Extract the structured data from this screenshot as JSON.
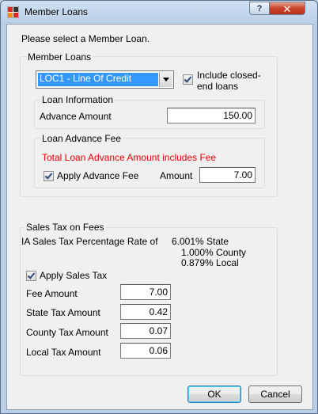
{
  "window": {
    "title": "Member Loans",
    "help_label": "?",
    "close_label": "✕"
  },
  "prompt": "Please select a Member Loan.",
  "member_loans": {
    "legend": "Member Loans",
    "selected_loan": "LOC1 - Line Of Credit",
    "include_closed_label_line1": "Include closed-",
    "include_closed_label_line2": "end loans",
    "include_closed_checked": true,
    "loan_information": {
      "legend": "Loan Information",
      "advance_amount_label": "Advance Amount",
      "advance_amount_value": "150.00"
    },
    "loan_advance_fee": {
      "legend": "Loan Advance Fee",
      "notice": "Total Loan Advance Amount includes Fee",
      "apply_fee_label": "Apply Advance Fee",
      "apply_fee_checked": true,
      "amount_label": "Amount",
      "amount_value": "7.00"
    }
  },
  "sales_tax": {
    "legend": "Sales Tax on Fees",
    "rate_label": "IA Sales Tax Percentage Rate of",
    "state_rate": "6.001% State",
    "county_rate": "1.000% County",
    "local_rate": "0.879% Local",
    "apply_label": "Apply Sales Tax",
    "apply_checked": true,
    "fee_amount_label": "Fee Amount",
    "fee_amount_value": "7.00",
    "state_tax_label": "State Tax Amount",
    "state_tax_value": "0.42",
    "county_tax_label": "County Tax Amount",
    "county_tax_value": "0.07",
    "local_tax_label": "Local Tax Amount",
    "local_tax_value": "0.06"
  },
  "buttons": {
    "ok_label": "OK",
    "cancel_label": "Cancel"
  },
  "colors": {
    "selection": "#3399ff",
    "notice": "#e60000",
    "close_button": "#c8442b"
  }
}
